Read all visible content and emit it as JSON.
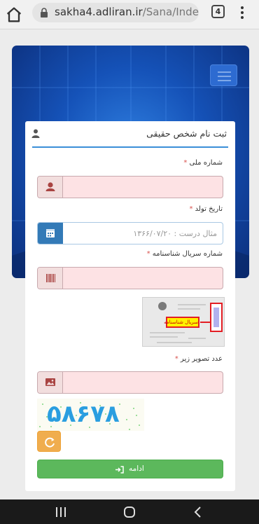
{
  "browser": {
    "url_host": "sakha4.adliran.ir",
    "url_path": "/Sana/Inde",
    "tab_count": "4"
  },
  "form": {
    "title": "ثبت نام شخص حقیقی",
    "national_id": {
      "label": "شماره ملی",
      "required": "*",
      "value": ""
    },
    "birth_date": {
      "label": "تاریخ تولد",
      "required": "*",
      "placeholder": "مثال درست : ۱۳۶۶/۰۷/۲۰"
    },
    "id_serial": {
      "label": "شماره سریال شناسنامه",
      "required": "*",
      "value": "",
      "sample_caption": "سریال شناسنامه"
    },
    "captcha_input": {
      "label": "عدد تصویر زیر",
      "required": "*",
      "value": ""
    },
    "captcha_code": "۵۸۶۷۸",
    "continue_label": "ادامه"
  },
  "colors": {
    "primary": "#337ab7",
    "success": "#5cb85c",
    "warning": "#f0ad4e",
    "error_bg": "#fde2e4",
    "required": "#d9534f"
  },
  "icons": [
    "home-icon",
    "lock-icon",
    "kebab-menu-icon",
    "hamburger-icon",
    "user-icon",
    "calendar-icon",
    "barcode-icon",
    "image-icon",
    "refresh-icon",
    "sign-in-icon",
    "recents-icon",
    "home-nav-icon",
    "back-icon"
  ]
}
